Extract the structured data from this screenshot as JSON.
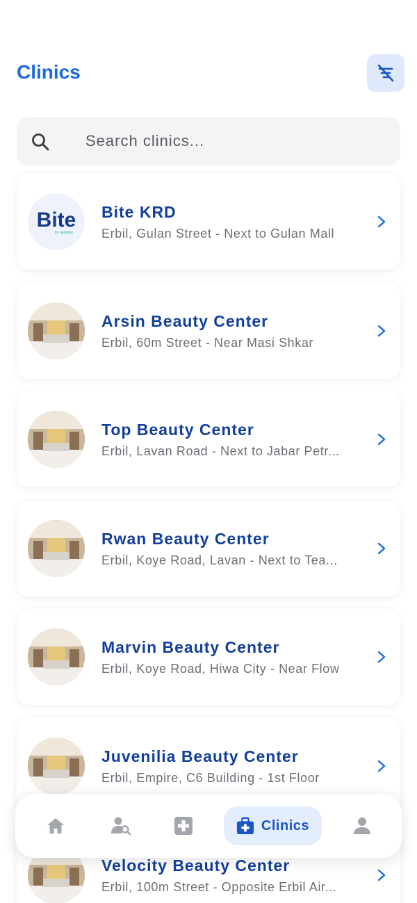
{
  "header": {
    "title": "Clinics",
    "filter_icon": "filter-off-icon"
  },
  "search": {
    "placeholder": "Search clinics...",
    "icon": "search-icon"
  },
  "clinics": [
    {
      "name": "Bite KRD",
      "address": "Erbil, Gulan Street - Next to Gulan Mall",
      "logo_text": "Bite",
      "logo_sub": "for dentistry"
    },
    {
      "name": "Arsin Beauty Center",
      "address": "Erbil, 60m Street - Near Masi Shkar"
    },
    {
      "name": "Top Beauty Center",
      "address": "Erbil, Lavan Road - Next to Jabar Petr..."
    },
    {
      "name": "Rwan Beauty Center",
      "address": "Erbil, Koye Road, Lavan - Next to Tea..."
    },
    {
      "name": "Marvin Beauty Center",
      "address": "Erbil, Koye Road, Hiwa City - Near Flow"
    },
    {
      "name": "Juvenilia Beauty Center",
      "address": "Erbil, Empire, C6 Building - 1st Floor"
    },
    {
      "name": "Velocity Beauty Center",
      "address": "Erbil, 100m Street - Opposite Erbil Air..."
    }
  ],
  "nav": {
    "items": [
      {
        "icon": "home-icon"
      },
      {
        "icon": "doctor-search-icon"
      },
      {
        "icon": "medical-cross-icon"
      },
      {
        "icon": "medical-kit-icon",
        "label": "Clinics",
        "active": true
      },
      {
        "icon": "person-icon"
      }
    ]
  },
  "colors": {
    "accent": "#1a6ae0",
    "name": "#123f9b",
    "nav_active_bg": "#e3edfc"
  }
}
